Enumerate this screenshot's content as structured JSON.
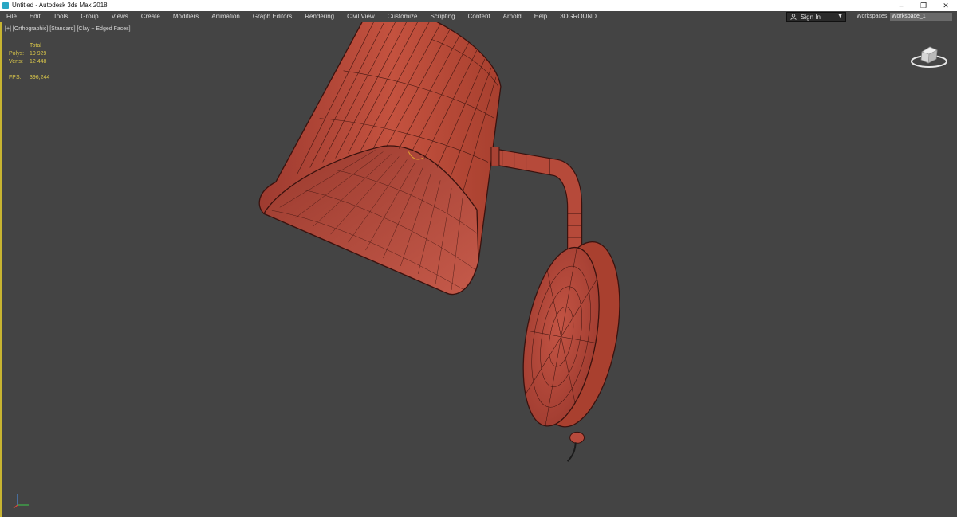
{
  "window": {
    "title": "Untitled - Autodesk 3ds Max 2018",
    "controls": {
      "minimize": "–",
      "restore": "❐",
      "close": "✕"
    }
  },
  "menu": [
    "File",
    "Edit",
    "Tools",
    "Group",
    "Views",
    "Create",
    "Modifiers",
    "Animation",
    "Graph Editors",
    "Rendering",
    "Civil View",
    "Customize",
    "Scripting",
    "Content",
    "Arnold",
    "Help",
    "3DGROUND"
  ],
  "signin": {
    "label": "Sign In"
  },
  "workspaces": {
    "label": "Workspaces:",
    "value": "Workspace_1"
  },
  "viewport": {
    "label": "[+] [Orthographic] [Standard] [Clay + Edged Faces]",
    "stats": {
      "header": "Total",
      "polys_label": "Polys:",
      "polys_value": "19 929",
      "verts_label": "Verts:",
      "verts_value": "12 448",
      "fps_label": "FPS:",
      "fps_value": "396,244"
    }
  },
  "colors": {
    "accent_border": "#c7b431",
    "stats_text": "#d9c64a",
    "model_fill": "#b84a3c",
    "model_wire": "#3a120e",
    "background": "#444444"
  },
  "icons": [
    "app-icon",
    "user-icon",
    "viewcube-icon",
    "axis-tripod-icon"
  ]
}
